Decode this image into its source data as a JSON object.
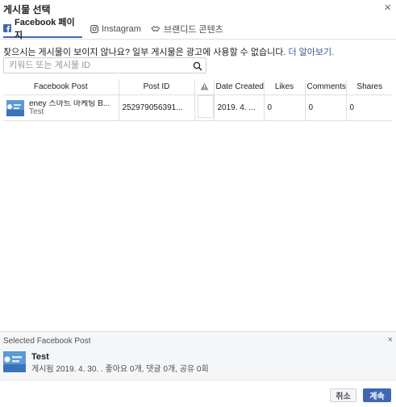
{
  "dialog": {
    "title": "게시물 선택",
    "close_glyph": "×"
  },
  "tabs": [
    {
      "label": "Facebook 페이지",
      "icon": "facebook-icon",
      "active": true
    },
    {
      "label": "Instagram",
      "icon": "instagram-icon",
      "active": false
    },
    {
      "label": "브랜디드 콘텐츠",
      "icon": "handshake-icon",
      "active": false
    }
  ],
  "hint": {
    "text": "찾으시는 게시물이 보이지 않나요? 일부 게시물은 광고에 사용할 수 없습니다.",
    "link": "더 알아보기."
  },
  "search": {
    "placeholder": "키워드 또는 게시물 ID",
    "value": ""
  },
  "table": {
    "columns": [
      "Facebook Post",
      "Post ID",
      "",
      "Date Created",
      "Likes",
      "Comments",
      "Shares"
    ],
    "rows": [
      {
        "title": "eney 스마트 마케팅 B...",
        "subtitle": "Test",
        "post_id": "252979056391...",
        "date": "2019. 4. ...",
        "likes": "0",
        "comments": "0",
        "shares": "0"
      }
    ]
  },
  "selected": {
    "header": "Selected Facebook Post",
    "close_glyph": "×",
    "name": "Test",
    "meta": "게시됨 2019. 4. 30. . 좋아요 0개, 댓글 0개, 공유 0회"
  },
  "footer": {
    "cancel_label": "취소",
    "continue_label": "계속"
  },
  "colors": {
    "accent": "#4267b2",
    "link": "#385898",
    "border": "#dddfe2"
  }
}
